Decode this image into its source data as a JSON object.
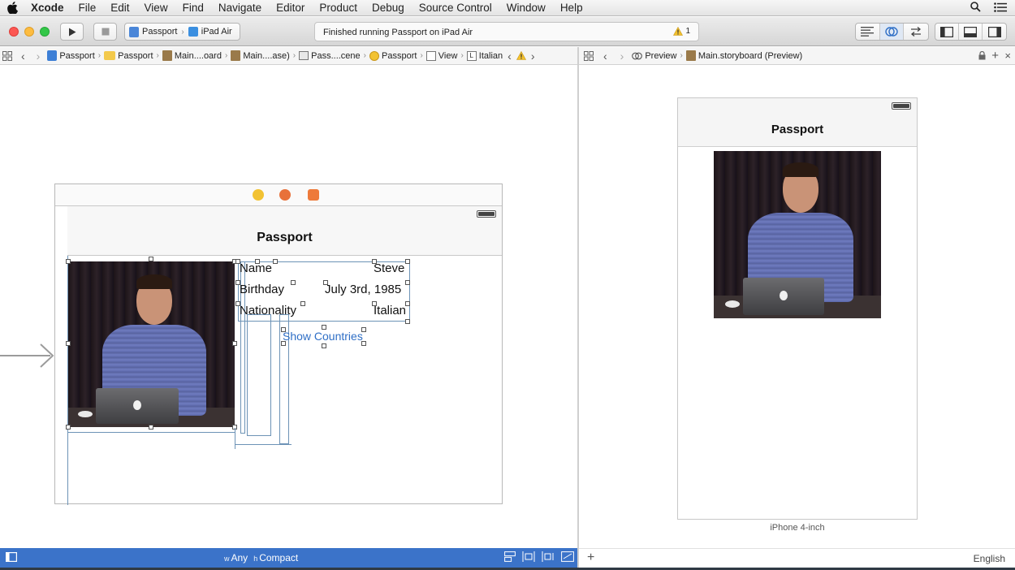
{
  "menubar": {
    "app": "Xcode",
    "items": [
      "File",
      "Edit",
      "View",
      "Find",
      "Navigate",
      "Editor",
      "Product",
      "Debug",
      "Source Control",
      "Window",
      "Help"
    ]
  },
  "toolbar": {
    "scheme_target": "Passport",
    "scheme_device": "iPad Air",
    "status_text": "Finished running Passport on iPad Air",
    "warning_count": "1"
  },
  "jumpbar_left": {
    "crumbs": [
      "Passport",
      "Passport",
      "Main....oard",
      "Main....ase)",
      "Pass....cene",
      "Passport",
      "View",
      "Italian"
    ]
  },
  "jumpbar_right": {
    "mode": "Preview",
    "file": "Main.storyboard (Preview)"
  },
  "scene": {
    "nav_title": "Passport",
    "labels": {
      "name_key": "Name",
      "name_value": "Steve",
      "birthday_key": "Birthday",
      "birthday_value": "July 3rd, 1985",
      "nationality_key": "Nationality",
      "nationality_value": "Italian"
    },
    "button": "Show Countries"
  },
  "preview": {
    "nav_title": "Passport",
    "device_label": "iPhone 4-inch",
    "language": "English"
  },
  "sizebar": {
    "width_prefix": "w",
    "width_value": "Any",
    "height_prefix": "h",
    "height_value": "Compact"
  },
  "colors": {
    "accent": "#3b73c9",
    "button_text": "#2f6fc6",
    "constraint": "#6d93b6"
  }
}
